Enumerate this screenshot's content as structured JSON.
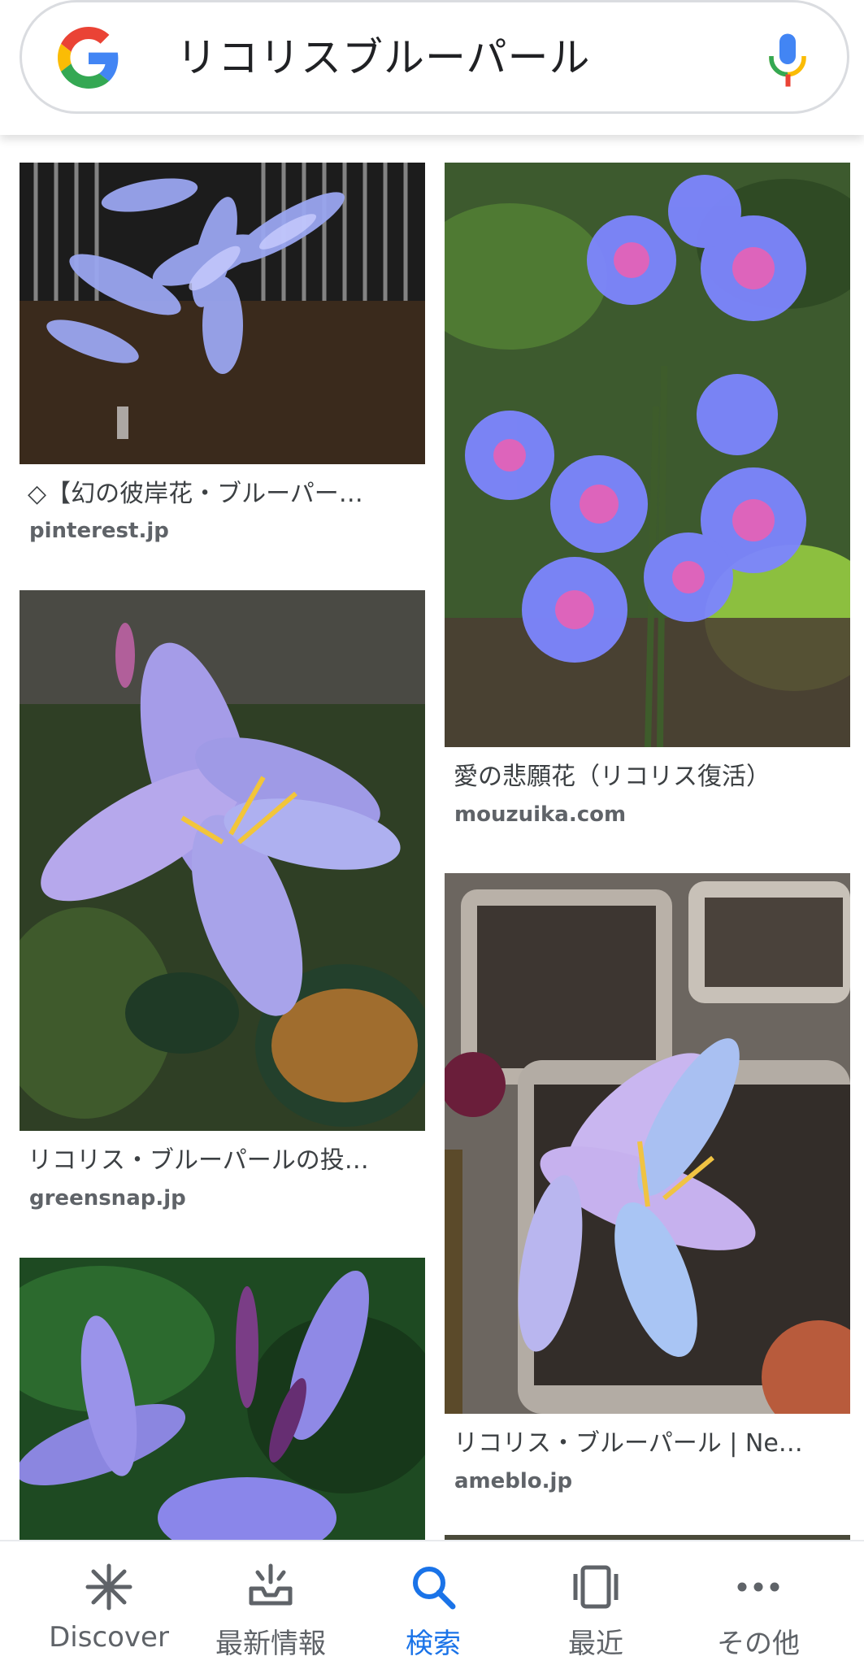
{
  "search": {
    "query": "リコリスブルーパール",
    "logo": "google-g-logo",
    "mic_icon": "mic-icon"
  },
  "results": [
    {
      "title": "◇【幻の彼岸花・ブルーパー…",
      "source": "pinterest.jp"
    },
    {
      "title": "愛の悲願花（リコリス復活）",
      "source": "mouzuika.com"
    },
    {
      "title": "リコリス・ブルーパールの投…",
      "source": "greensnap.jp"
    },
    {
      "title": "リコリス・ブルーパール | Ne…",
      "source": "ameblo.jp"
    }
  ],
  "nav": {
    "items": [
      {
        "label": "Discover",
        "icon": "asterisk-icon"
      },
      {
        "label": "最新情報",
        "icon": "updates-tray-icon"
      },
      {
        "label": "検索",
        "icon": "search-icon"
      },
      {
        "label": "最近",
        "icon": "recent-cards-icon"
      },
      {
        "label": "その他",
        "icon": "more-dots-icon"
      }
    ],
    "active": "検索"
  },
  "colors": {
    "accent": "#1a73e8",
    "nav_text": "#5f6368",
    "source_text": "#5f6368"
  }
}
